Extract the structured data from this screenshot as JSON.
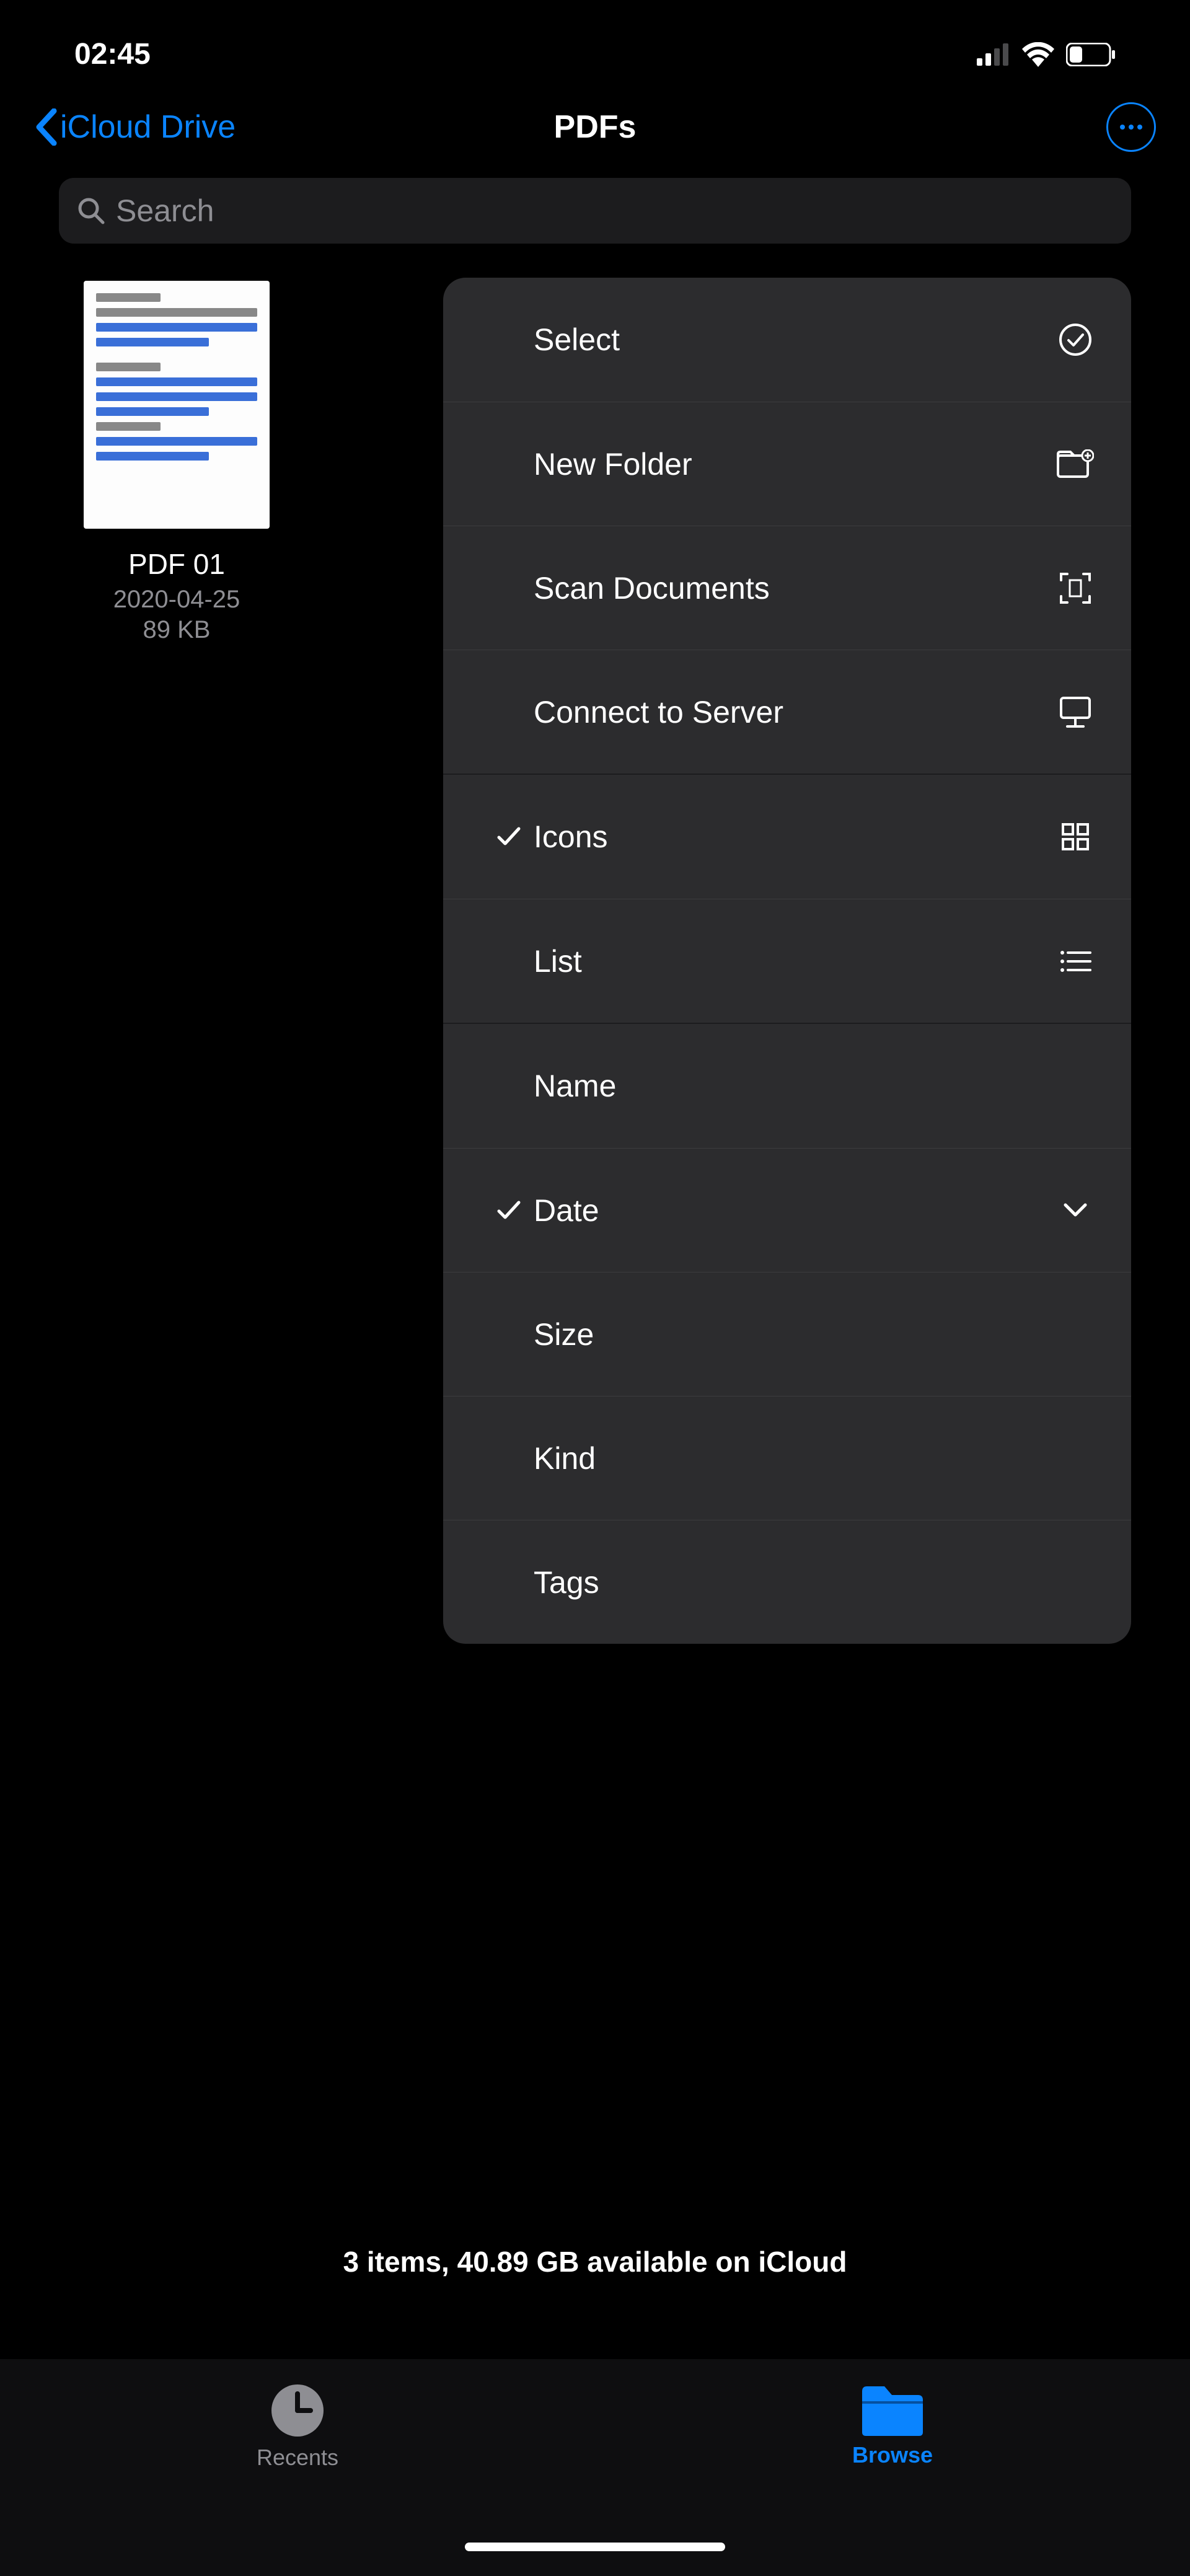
{
  "statusbar": {
    "time": "02:45"
  },
  "nav": {
    "back_label": "iCloud Drive",
    "title": "PDFs"
  },
  "search": {
    "placeholder": "Search"
  },
  "files": [
    {
      "name": "PDF 01",
      "date": "2020-04-25",
      "size": "89 KB"
    }
  ],
  "menu": {
    "actions": {
      "select": "Select",
      "new_folder": "New Folder",
      "scan_documents": "Scan Documents",
      "connect_server": "Connect to Server"
    },
    "view": {
      "icons": "Icons",
      "list": "List",
      "active": "icons"
    },
    "sort": {
      "name": "Name",
      "date": "Date",
      "size": "Size",
      "kind": "Kind",
      "tags": "Tags",
      "active": "date"
    }
  },
  "footer": {
    "status": "3 items, 40.89 GB available on iCloud"
  },
  "tabs": {
    "recents": "Recents",
    "browse": "Browse",
    "active": "browse"
  }
}
